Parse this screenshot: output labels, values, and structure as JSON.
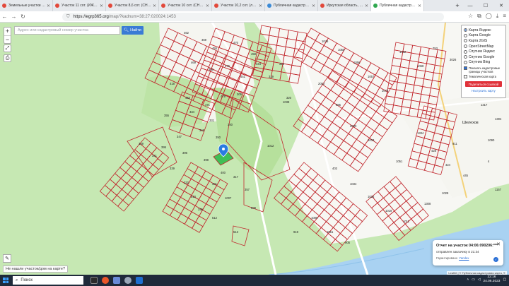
{
  "browser": {
    "tabs": [
      {
        "label": "Земельные участки в Ир...",
        "color": "#e2483a",
        "active": false
      },
      {
        "label": "Участок 11 сот. (ИЖС) в...",
        "color": "#e2483a",
        "active": false
      },
      {
        "label": "Участок 8,6 сот. (СНТ, ДН...",
        "color": "#e2483a",
        "active": false
      },
      {
        "label": "Участок 10 сот. (СНТ, ДН...",
        "color": "#e2483a",
        "active": false
      },
      {
        "label": "Участок 10,2 сот. (личнос...",
        "color": "#e2483a",
        "active": false
      },
      {
        "label": "Публичная кадастровая к...",
        "color": "#3b8ad6",
        "active": false
      },
      {
        "label": "Иркутская область, Шелех...",
        "color": "#e2483a",
        "active": false
      },
      {
        "label": "Публичная кадастровая...",
        "color": "#2fa84f",
        "active": true
      }
    ],
    "new_tab": "+",
    "url_host": "https://egrp365.org",
    "url_path": "/map/?kadnum=38:27:020024:1453"
  },
  "map_ui": {
    "zoom_in": "+",
    "zoom_out": "−",
    "search_placeholder": "Адрес или кадастровый номер участка",
    "find_button": "Найти",
    "not_found": "Не нашли участок/дом на карте?",
    "attribution": "Leaflet | © Публичная кадастровая карта, ©",
    "town_label": "Шелехов"
  },
  "layers": {
    "options": [
      {
        "label": "Карта Яндекс",
        "selected": true
      },
      {
        "label": "Карта Google",
        "selected": false
      },
      {
        "label": "Карта 2GIS",
        "selected": false
      },
      {
        "label": "OpenStreetMap",
        "selected": false
      },
      {
        "label": "Спутник Яндекс",
        "selected": false
      },
      {
        "label": "Спутник Google",
        "selected": false
      },
      {
        "label": "Спутник Bing",
        "selected": false
      }
    ],
    "show_borders": "Показать кадастровые границы участков",
    "show_thematic": "Тематическая карта",
    "share_button": "Поделиться ссылкой",
    "setup_link": "Настроить карту"
  },
  "toast": {
    "title": "Отчет на участок 04:06:090206:***",
    "subtitle": "отправлен заказчику в 21:34",
    "guarantee": "Гарантировано",
    "link": "Yandex"
  },
  "taskbar": {
    "search": "Поиск",
    "time": "22:16",
    "date": "24.06.2023"
  },
  "parcel_labels": [
    "462",
    "459",
    "455",
    "470",
    "458",
    "469",
    "466",
    "476",
    "441",
    "444",
    "418",
    "452",
    "471",
    "479",
    "306",
    "319",
    "323",
    "320",
    "355",
    "334",
    "331",
    "340",
    "347",
    "346",
    "350",
    "395",
    "396",
    "398",
    "400",
    "317",
    "357",
    "301",
    "1007",
    "509",
    "345",
    "349",
    "341",
    "339",
    "332",
    "510",
    "512",
    "513",
    "1012",
    "1038",
    "1046",
    "1050",
    "1056",
    "1057",
    "1078",
    "1062",
    "1068",
    "753",
    "3026",
    "1335",
    "1317",
    "1304",
    "1334",
    "428",
    "424",
    "445",
    "4",
    "403",
    "1034",
    "1026",
    "1019",
    "1011",
    "1308",
    "1028",
    "1085",
    "1051",
    "905",
    "919",
    "911",
    "1090",
    "1157",
    "1051",
    "1033",
    "2030",
    "885",
    "2052"
  ]
}
